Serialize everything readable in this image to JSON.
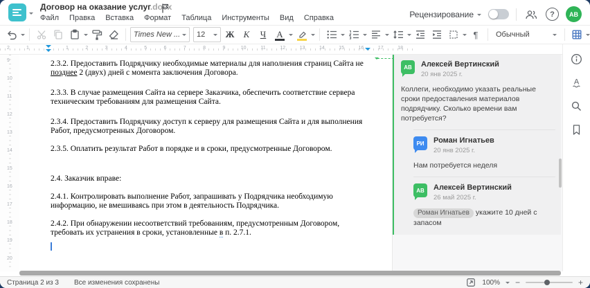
{
  "header": {
    "title": "Договор на оказание услуг",
    "title_ext": ".docx",
    "menu": [
      "Файл",
      "Правка",
      "Вставка",
      "Формат",
      "Таблица",
      "Инструменты",
      "Вид",
      "Справка"
    ],
    "review_label": "Рецензирование",
    "avatar_initials": "АВ",
    "help_label": "?"
  },
  "toolbar": {
    "font_name": "Times New ...",
    "font_size": "12",
    "bold_label": "Ж",
    "italic_label": "К",
    "underline_label": "Ч",
    "font_color_label": "А",
    "pilcrow_label": "¶",
    "style_name": "Обычный",
    "more_label": "•••",
    "accent_blue": "#4a78c2",
    "highlight_yellow": "#f7d448"
  },
  "ruler": {
    "h_left": [
      "2",
      "1"
    ],
    "h_units": [
      "1",
      "2",
      "3",
      "4",
      "5",
      "6",
      "7",
      "8",
      "9",
      "10",
      "11",
      "12",
      "13",
      "14",
      "15",
      "16",
      "17",
      "18"
    ],
    "v_units": [
      "9",
      "10",
      "11",
      "12",
      "13",
      "14",
      "15",
      "16",
      "17",
      "18",
      "19",
      "20"
    ]
  },
  "document": {
    "p1_pre": "2.3.2. Предоставить Подрядчику необходимые материалы для наполнения страниц Сайта не ",
    "p1_underlined": "позднее",
    "p1_post": " 2 (двух) дней с момента заключения Договора.",
    "p2": "2.3.3. В случае размещения Сайта на сервере Заказчика, обеспечить соответствие сервера техническим требованиям для размещения Сайта.",
    "p3": "2.3.4. Предоставить Подрядчику доступ к серверу для размещения Сайта и для выполнения Работ, предусмотренных Договором.",
    "p4": "2.3.5. Оплатить результат Работ в порядке и в сроки, предусмотренные Договором.",
    "p5": "2.4. Заказчик вправе:",
    "p6": "2.4.1. Контролировать выполнение Работ, запрашивать у Подрядчика необходимую информацию, не вмешиваясь при этом в деятельность Подрядчика.",
    "p7_pre": "2.4.2. При обнаружении несоответствий требованиям, предусмотренным Договором, требовать их устранения в сроки, установленные ",
    "p7_spell": "в",
    "p7_post": " п. 2.7.1."
  },
  "comments": {
    "accent_green": "#3dbe64",
    "thread": [
      {
        "initials": "АВ",
        "name": "Алексей Вертинский",
        "date": "20 янв 2025 г.",
        "text": "Коллеги, необходимо указать реальные сроки предоставления материалов подрядчику. Сколько времени вам потребуется?"
      },
      {
        "initials": "РИ",
        "name": "Роман Игнатьев",
        "date": "20 янв 2025 г.",
        "text": "Нам потребуется неделя"
      },
      {
        "initials": "АВ",
        "name": "Алексей Вертинский",
        "date": "26 май 2025 г.",
        "mention": "Роман Игнатьев",
        "text": " укажите 10 дней с запасом"
      }
    ]
  },
  "statusbar": {
    "page_label": "Страница 2 из 3",
    "saved_label": "Все изменения сохранены",
    "zoom_value": "100%",
    "zoom_minus": "−",
    "zoom_plus": "+"
  }
}
